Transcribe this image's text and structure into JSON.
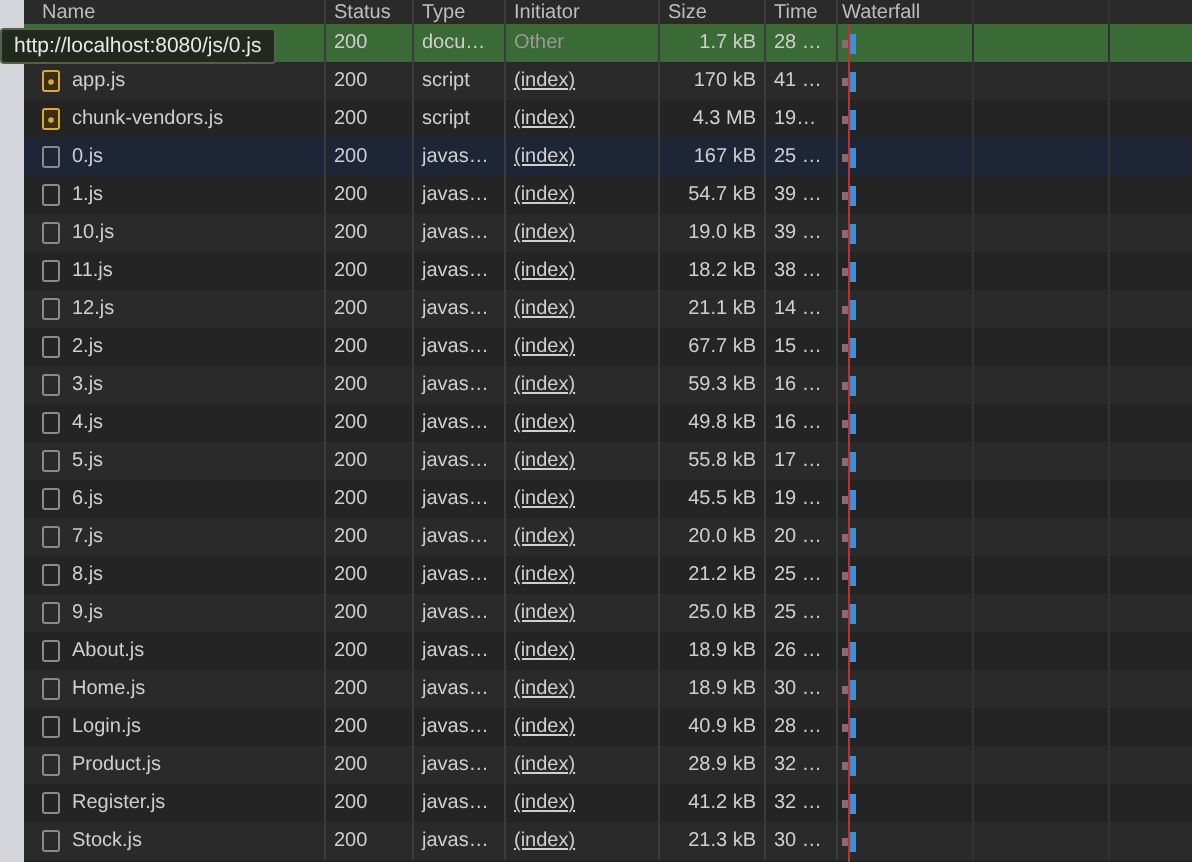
{
  "header": {
    "columns": [
      "Name",
      "Status",
      "Type",
      "Initiator",
      "Size",
      "Time",
      "Waterfall"
    ]
  },
  "tooltip": {
    "text": "http://localhost:8080/js/0.js"
  },
  "rows": [
    {
      "kind": "document",
      "name": null,
      "status": "200",
      "type": "docu…",
      "initiator": "Other",
      "initiator_link": false,
      "size": "1.7 kB",
      "time": "28 …",
      "selected": true,
      "highlighted": false
    },
    {
      "kind": "script",
      "name": "app.js",
      "status": "200",
      "type": "script",
      "initiator": "(index)",
      "initiator_link": true,
      "size": "170 kB",
      "time": "41 …",
      "selected": false,
      "highlighted": false
    },
    {
      "kind": "script",
      "name": "chunk-vendors.js",
      "status": "200",
      "type": "script",
      "initiator": "(index)",
      "initiator_link": true,
      "size": "4.3 MB",
      "time": "19…",
      "selected": false,
      "highlighted": false
    },
    {
      "kind": "file",
      "name": "0.js",
      "status": "200",
      "type": "javas…",
      "initiator": "(index)",
      "initiator_link": true,
      "size": "167 kB",
      "time": "25 …",
      "selected": false,
      "highlighted": true
    },
    {
      "kind": "file",
      "name": "1.js",
      "status": "200",
      "type": "javas…",
      "initiator": "(index)",
      "initiator_link": true,
      "size": "54.7 kB",
      "time": "39 …",
      "selected": false,
      "highlighted": false
    },
    {
      "kind": "file",
      "name": "10.js",
      "status": "200",
      "type": "javas…",
      "initiator": "(index)",
      "initiator_link": true,
      "size": "19.0 kB",
      "time": "39 …",
      "selected": false,
      "highlighted": false
    },
    {
      "kind": "file",
      "name": "11.js",
      "status": "200",
      "type": "javas…",
      "initiator": "(index)",
      "initiator_link": true,
      "size": "18.2 kB",
      "time": "38 …",
      "selected": false,
      "highlighted": false
    },
    {
      "kind": "file",
      "name": "12.js",
      "status": "200",
      "type": "javas…",
      "initiator": "(index)",
      "initiator_link": true,
      "size": "21.1 kB",
      "time": "14 …",
      "selected": false,
      "highlighted": false
    },
    {
      "kind": "file",
      "name": "2.js",
      "status": "200",
      "type": "javas…",
      "initiator": "(index)",
      "initiator_link": true,
      "size": "67.7 kB",
      "time": "15 …",
      "selected": false,
      "highlighted": false
    },
    {
      "kind": "file",
      "name": "3.js",
      "status": "200",
      "type": "javas…",
      "initiator": "(index)",
      "initiator_link": true,
      "size": "59.3 kB",
      "time": "16 …",
      "selected": false,
      "highlighted": false
    },
    {
      "kind": "file",
      "name": "4.js",
      "status": "200",
      "type": "javas…",
      "initiator": "(index)",
      "initiator_link": true,
      "size": "49.8 kB",
      "time": "16 …",
      "selected": false,
      "highlighted": false
    },
    {
      "kind": "file",
      "name": "5.js",
      "status": "200",
      "type": "javas…",
      "initiator": "(index)",
      "initiator_link": true,
      "size": "55.8 kB",
      "time": "17 …",
      "selected": false,
      "highlighted": false
    },
    {
      "kind": "file",
      "name": "6.js",
      "status": "200",
      "type": "javas…",
      "initiator": "(index)",
      "initiator_link": true,
      "size": "45.5 kB",
      "time": "19 …",
      "selected": false,
      "highlighted": false
    },
    {
      "kind": "file",
      "name": "7.js",
      "status": "200",
      "type": "javas…",
      "initiator": "(index)",
      "initiator_link": true,
      "size": "20.0 kB",
      "time": "20 …",
      "selected": false,
      "highlighted": false
    },
    {
      "kind": "file",
      "name": "8.js",
      "status": "200",
      "type": "javas…",
      "initiator": "(index)",
      "initiator_link": true,
      "size": "21.2 kB",
      "time": "25 …",
      "selected": false,
      "highlighted": false
    },
    {
      "kind": "file",
      "name": "9.js",
      "status": "200",
      "type": "javas…",
      "initiator": "(index)",
      "initiator_link": true,
      "size": "25.0 kB",
      "time": "25 …",
      "selected": false,
      "highlighted": false
    },
    {
      "kind": "file",
      "name": "About.js",
      "status": "200",
      "type": "javas…",
      "initiator": "(index)",
      "initiator_link": true,
      "size": "18.9 kB",
      "time": "26 …",
      "selected": false,
      "highlighted": false
    },
    {
      "kind": "file",
      "name": "Home.js",
      "status": "200",
      "type": "javas…",
      "initiator": "(index)",
      "initiator_link": true,
      "size": "18.9 kB",
      "time": "30 …",
      "selected": false,
      "highlighted": false
    },
    {
      "kind": "file",
      "name": "Login.js",
      "status": "200",
      "type": "javas…",
      "initiator": "(index)",
      "initiator_link": true,
      "size": "40.9 kB",
      "time": "28 …",
      "selected": false,
      "highlighted": false
    },
    {
      "kind": "file",
      "name": "Product.js",
      "status": "200",
      "type": "javas…",
      "initiator": "(index)",
      "initiator_link": true,
      "size": "28.9 kB",
      "time": "32 …",
      "selected": false,
      "highlighted": false
    },
    {
      "kind": "file",
      "name": "Register.js",
      "status": "200",
      "type": "javas…",
      "initiator": "(index)",
      "initiator_link": true,
      "size": "41.2 kB",
      "time": "32 …",
      "selected": false,
      "highlighted": false
    },
    {
      "kind": "file",
      "name": "Stock.js",
      "status": "200",
      "type": "javas…",
      "initiator": "(index)",
      "initiator_link": true,
      "size": "21.3 kB",
      "time": "30 …",
      "selected": false,
      "highlighted": false
    }
  ]
}
